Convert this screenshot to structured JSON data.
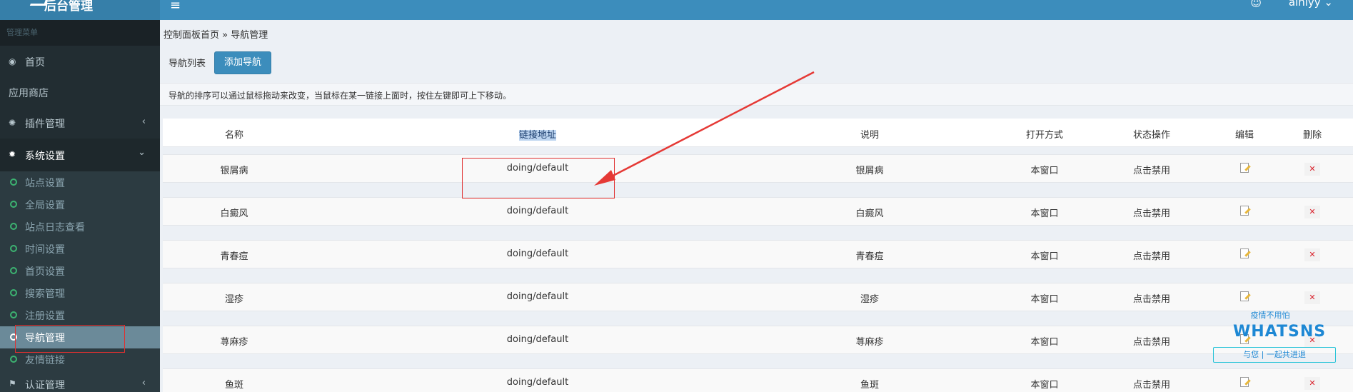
{
  "header": {
    "logo_text": "后台管理",
    "menu_toggle": "≡",
    "user_name": "ainiyy",
    "notify_icon": "☺"
  },
  "sidebar": {
    "section_title": "管理菜单",
    "items": [
      {
        "label": "首页",
        "icon": "dashboard-icon"
      },
      {
        "label": "应用商店",
        "icon": ""
      },
      {
        "label": "插件管理",
        "icon": "plugin-icon"
      },
      {
        "label": "系统设置",
        "icon": "gear-icon"
      }
    ],
    "sub_items": [
      {
        "label": "站点设置"
      },
      {
        "label": "全局设置"
      },
      {
        "label": "站点日志查看"
      },
      {
        "label": "时间设置"
      },
      {
        "label": "首页设置"
      },
      {
        "label": "搜索管理"
      },
      {
        "label": "注册设置"
      },
      {
        "label": "导航管理"
      },
      {
        "label": "友情链接"
      }
    ],
    "bottom_item": {
      "label": "认证管理",
      "icon": "certificate-icon"
    },
    "active_sub": "导航管理"
  },
  "main": {
    "breadcrumb": "控制面板首页 » 导航管理",
    "list_label": "导航列表",
    "add_button": "添加导航",
    "notice": "导航的排序可以通过鼠标拖动来改变，当鼠标在某一链接上面时，按住左键即可上下移动。",
    "table": {
      "headers": [
        "名称",
        "链接地址",
        "说明",
        "打开方式",
        "状态操作",
        "编辑",
        "删除"
      ],
      "rows": [
        {
          "name": "银屑病",
          "url": "doing/default",
          "desc": "银屑病",
          "open": "本窗口",
          "status": "点击禁用"
        },
        {
          "name": "白癜风",
          "url": "doing/default",
          "desc": "白癜风",
          "open": "本窗口",
          "status": "点击禁用"
        },
        {
          "name": "青春痘",
          "url": "doing/default",
          "desc": "青春痘",
          "open": "本窗口",
          "status": "点击禁用"
        },
        {
          "name": "湿疹",
          "url": "doing/default",
          "desc": "湿疹",
          "open": "本窗口",
          "status": "点击禁用"
        },
        {
          "name": "荨麻疹",
          "url": "doing/default",
          "desc": "荨麻疹",
          "open": "本窗口",
          "status": "点击禁用"
        },
        {
          "name": "鱼斑",
          "url": "doing/default",
          "desc": "鱼斑",
          "open": "本窗口",
          "status": "点击禁用"
        }
      ]
    }
  },
  "watermark": {
    "top": "疫情不用怕",
    "brand": "WHATSNS",
    "bottom": "与您 | 一起共进退"
  },
  "colors": {
    "header": "#3c8dbc",
    "sidebar": "#222d32",
    "annotation": "#e03030"
  }
}
